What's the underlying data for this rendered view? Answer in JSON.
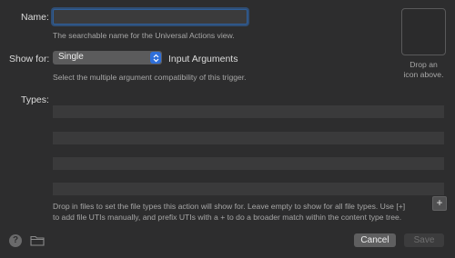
{
  "name_row": {
    "label": "Name:",
    "value": "",
    "hint": "The searchable name for the Universal Actions view."
  },
  "icon_well": {
    "hint_line1": "Drop an",
    "hint_line2": "icon above."
  },
  "show_for_row": {
    "label": "Show for:",
    "selected": "Single",
    "suffix": "Input Arguments",
    "hint": "Select the multiple argument compatibility of this trigger."
  },
  "types_row": {
    "label": "Types:",
    "row_count": 4
  },
  "types_hint": {
    "line1": "Drop in files to set the file types this action will show for. Leave empty to show for all file types. Use [+]",
    "line2": "to add file UTIs manually, and prefix UTIs with a + to do a broader match within the content type tree."
  },
  "add_button": {
    "label": "+"
  },
  "footer": {
    "help_label": "?",
    "cancel_label": "Cancel",
    "save_label": "Save"
  },
  "colors": {
    "background": "#2d2d2e",
    "focus_ring": "#3478cd",
    "popup_accent": "#2f6fd9"
  },
  "icons": [
    "chevron-updown-icon",
    "help-icon",
    "folder-icon"
  ]
}
